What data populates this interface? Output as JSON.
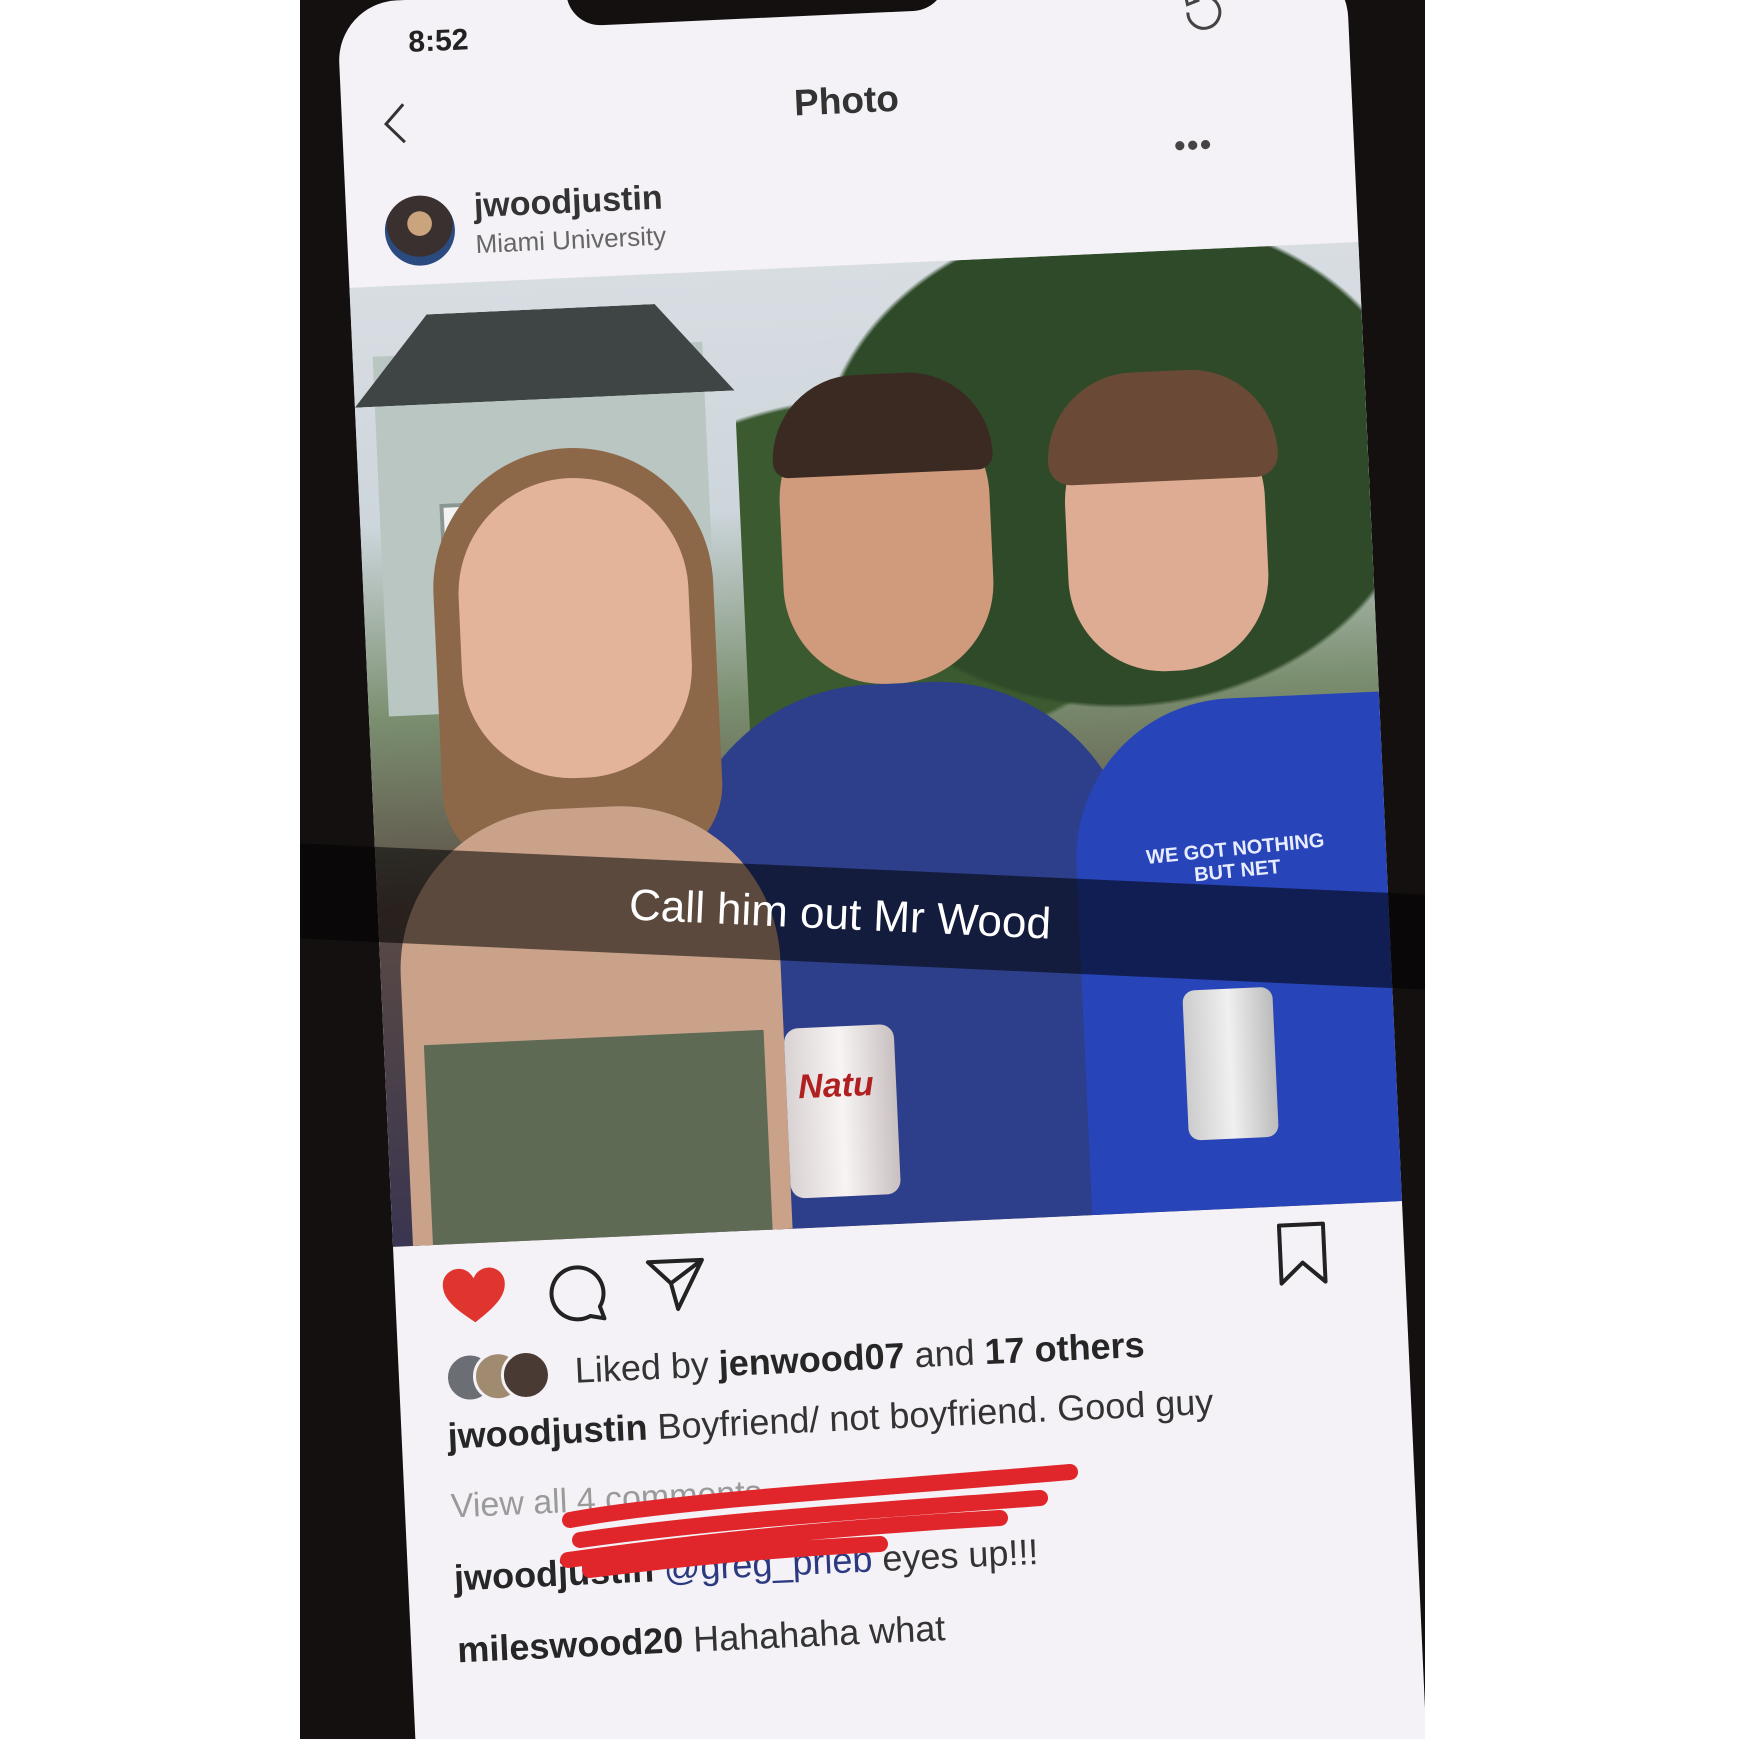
{
  "status_bar": {
    "time": "8:52"
  },
  "nav": {
    "title": "Photo"
  },
  "post": {
    "username": "jwoodjustin",
    "location": "Miami University",
    "shirt_text": "WE GOT NOTHING BUT NET",
    "can_text": "Natu",
    "overlay_caption": "Call him out Mr Wood"
  },
  "actions": {
    "liked": true,
    "like_color": "#e0342f"
  },
  "likes": {
    "prefix": "Liked by ",
    "user": "jenwood07",
    "middle": " and ",
    "others": "17 others"
  },
  "caption": {
    "user": "jwoodjustin",
    "text": " Boyfriend/ not boyfriend. Good guy"
  },
  "view_all_comments": "View all 4 comments",
  "comments": [
    {
      "user": "jwoodjustin",
      "mention": "@greg_prieb",
      "text": " eyes up!!!"
    },
    {
      "user": "mileswood20",
      "mention": "",
      "text": " Hahahaha what"
    }
  ]
}
